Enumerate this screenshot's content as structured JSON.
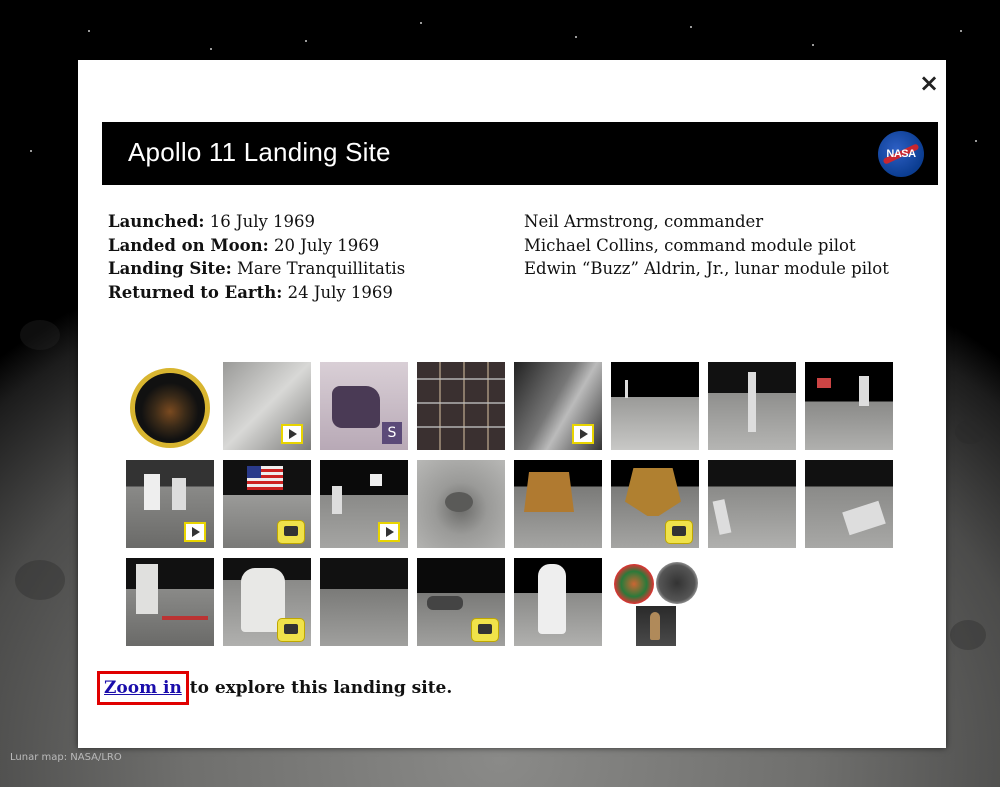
{
  "background": {
    "credit": "Lunar map: NASA/LRO"
  },
  "popup": {
    "close_label": "×",
    "title": "Apollo 11 Landing Site",
    "logo_text": "NASA",
    "mission_info": [
      {
        "label": "Launched:",
        "value": "16 July 1969"
      },
      {
        "label": "Landed on Moon:",
        "value": "20 July 1969"
      },
      {
        "label": "Landing Site:",
        "value": "Mare Tranquillitatis"
      },
      {
        "label": "Returned to Earth:",
        "value": "24 July 1969"
      }
    ],
    "crew": [
      "Neil Armstrong, commander",
      "Michael Collins, command module pilot",
      "Edwin “Buzz” Aldrin, Jr., lunar module pilot"
    ],
    "gallery_badges": {
      "sample_letter": "S"
    },
    "zoom_link": "Zoom in",
    "zoom_text": " to explore this landing site."
  },
  "colors": {
    "title_bar": "#000000",
    "link": "#1a0dab",
    "highlight_box": "#e00000",
    "badge_yellow": "#e8d400"
  }
}
